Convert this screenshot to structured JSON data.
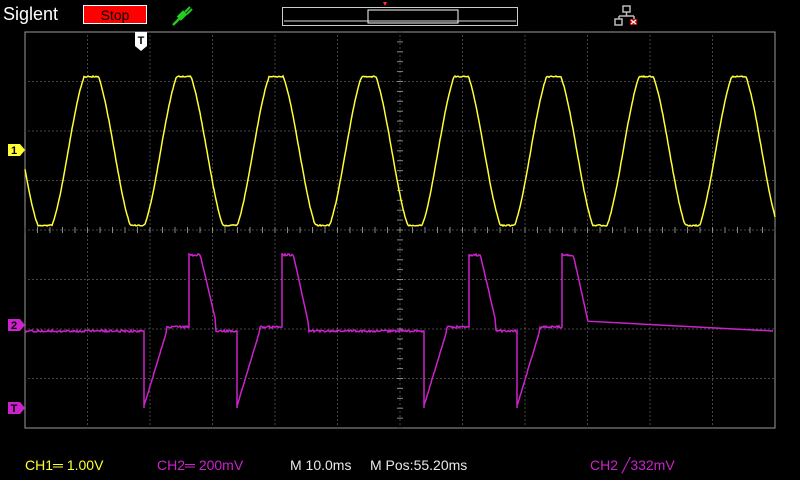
{
  "header": {
    "brand": "Siglent",
    "run_state": "Stop",
    "run_state_color": "#ff0000",
    "probe_icon": "probe-icon",
    "network_icon": "network-disconnected-icon"
  },
  "markers": {
    "trigger": "T",
    "ch1": "1",
    "ch2": "2",
    "trigger_level": "T"
  },
  "status": {
    "ch1": "CH1═ 1.00V",
    "ch2": "CH2═ 200mV",
    "timebase": "M 10.0ms",
    "position": "M Pos:55.20ms",
    "trigger": "CH2 ╱332mV"
  },
  "colors": {
    "ch1": "#ffff33",
    "ch2": "#cc22cc",
    "grid": "#7a7a7a",
    "background": "#000000"
  }
}
